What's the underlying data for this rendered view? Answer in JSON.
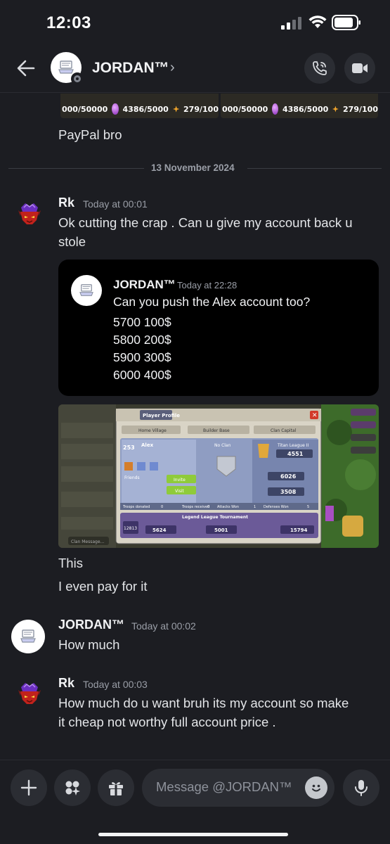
{
  "status_bar": {
    "time": "12:03"
  },
  "header": {
    "contact_name": "JORDAN™",
    "chevron": "›"
  },
  "preview_strip": {
    "left": {
      "elixir": "000/50000",
      "gems": "4386/5000",
      "trophies": "279/100"
    },
    "right": {
      "elixir": "000/50000",
      "gems": "4386/5000",
      "trophies": "279/100"
    }
  },
  "messages": {
    "paypal": "PayPal bro",
    "date_divider": "13 November 2024",
    "rk1": {
      "author": "Rk",
      "time": "Today at 00:01",
      "line1": "Ok cutting the crap . Can u give my account back u",
      "line2": "stole"
    },
    "embed": {
      "author": "JORDAN™",
      "time": "Today at 22:28",
      "lines": [
        "Can you push the Alex account too?",
        "5700 100$",
        "5800 200$",
        "5900 300$",
        "6000 400$"
      ]
    },
    "game_image": {
      "title": "Player Profile",
      "tabs": [
        "Home Village",
        "Builder Base",
        "Clan Capital"
      ],
      "player_name": "Alex",
      "level": "253",
      "clan": "No Clan",
      "league": "Titan League II",
      "trophies": "4551",
      "best_trophies": "6026",
      "war_stars": "3508",
      "friends": "Friends",
      "invite": "Invite",
      "visit": "Visit",
      "stats": [
        "Troops donated",
        "0",
        "Troops received",
        "0",
        "Attacks Won",
        "1",
        "Defenses Won",
        "5"
      ],
      "tournament": "Legend League Tournament",
      "tournament_rank": "12813",
      "best_season": "5624",
      "previous_season": "5001",
      "legend_trophies": "15794",
      "chat_placeholder": "Clan Message..."
    },
    "this": "This",
    "pay": "I even pay for it",
    "jordan": {
      "author": "JORDAN™",
      "time": "Today at 00:02",
      "text": "How much"
    },
    "rk2": {
      "author": "Rk",
      "time": "Today at 00:03",
      "line1": "How much do u want bruh its my account so make",
      "line2": "it cheap not worthy full account price ."
    }
  },
  "composer": {
    "placeholder": "Message @JORDAN™"
  }
}
